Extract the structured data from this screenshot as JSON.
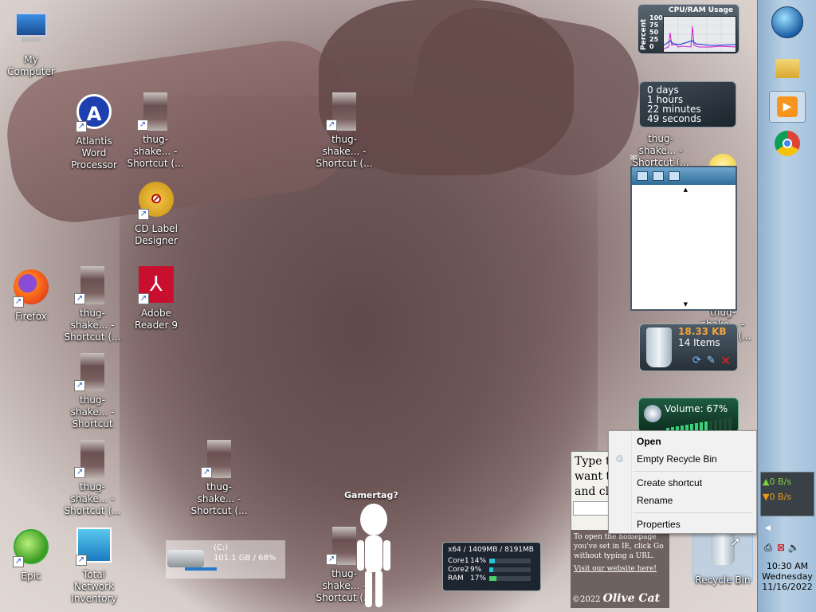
{
  "desktop": {
    "icons": [
      {
        "label": "My Computer"
      },
      {
        "label": "Atlantis Word Processor"
      },
      {
        "label": "thug-shake... - Shortcut (..."
      },
      {
        "label": "thug-shake... - Shortcut (..."
      },
      {
        "label": "CD Label Designer"
      },
      {
        "label": "Firefox"
      },
      {
        "label": "thug-shake... - Shortcut (..."
      },
      {
        "label": "Adobe Reader 9"
      },
      {
        "label": "thug-shake... - Shortcut"
      },
      {
        "label": "thug-shake... - Shortcut (..."
      },
      {
        "label": "thug-shake... - Shortcut (..."
      },
      {
        "label": "Epic"
      },
      {
        "label": "Total Network Inventory"
      },
      {
        "label": "thug-shake... - Shortcut (..."
      },
      {
        "label": "thug-shake... - Shortcut (..."
      },
      {
        "label": "thug-shake... - Shortcut (..."
      },
      {
        "label": "Recycle Bin"
      }
    ]
  },
  "gadgets": {
    "cpu_ram": {
      "title": "CPU/RAM Usage",
      "ylabel": "Percent",
      "ticks": [
        "100",
        "75",
        "50",
        "25",
        "0"
      ]
    },
    "uptime": {
      "days": "0 days",
      "hours": "1 hours",
      "minutes": "22 minutes",
      "seconds": "49 seconds"
    },
    "recycle": {
      "size": "18.33 KB",
      "items": "14 Items"
    },
    "volume": {
      "label": "Volume: 67%",
      "level": 0.67
    },
    "drive": {
      "letter": "(C:)",
      "usage": "101.1 GB / 68%",
      "fill": 0.68
    },
    "sysinfo": {
      "header": "x64 / 1409MB / 8191MB",
      "rows": [
        {
          "name": "Core1",
          "value": "14%",
          "level": 0.14
        },
        {
          "name": "Core2",
          "value": "9%",
          "level": 0.09
        },
        {
          "name": "RAM",
          "value": "17%",
          "level": 0.17
        }
      ]
    },
    "gamertag": "Gamertag?",
    "olive": {
      "line1": "Type th",
      "line2": "want to",
      "line3": "and clic",
      "info": "To open the homepage you've set in IE, click Go without typing a URL.",
      "link": "Visit our website here!",
      "copyright": "©2022",
      "brand": "Olive Cat"
    }
  },
  "context_menu": {
    "open": "Open",
    "empty": "Empty Recycle Bin",
    "create_shortcut": "Create shortcut",
    "rename": "Rename",
    "properties": "Properties"
  },
  "taskbar": {
    "net_up": "0 B/s",
    "net_down": "0 B/s",
    "time": "10:30 AM",
    "day": "Wednesday",
    "date": "11/16/2022"
  },
  "colors": {
    "taskbar": "#a4c1dc",
    "recycle_size": "#f3a53a",
    "net_up": "#7ed03a",
    "net_down": "#e99b12"
  }
}
